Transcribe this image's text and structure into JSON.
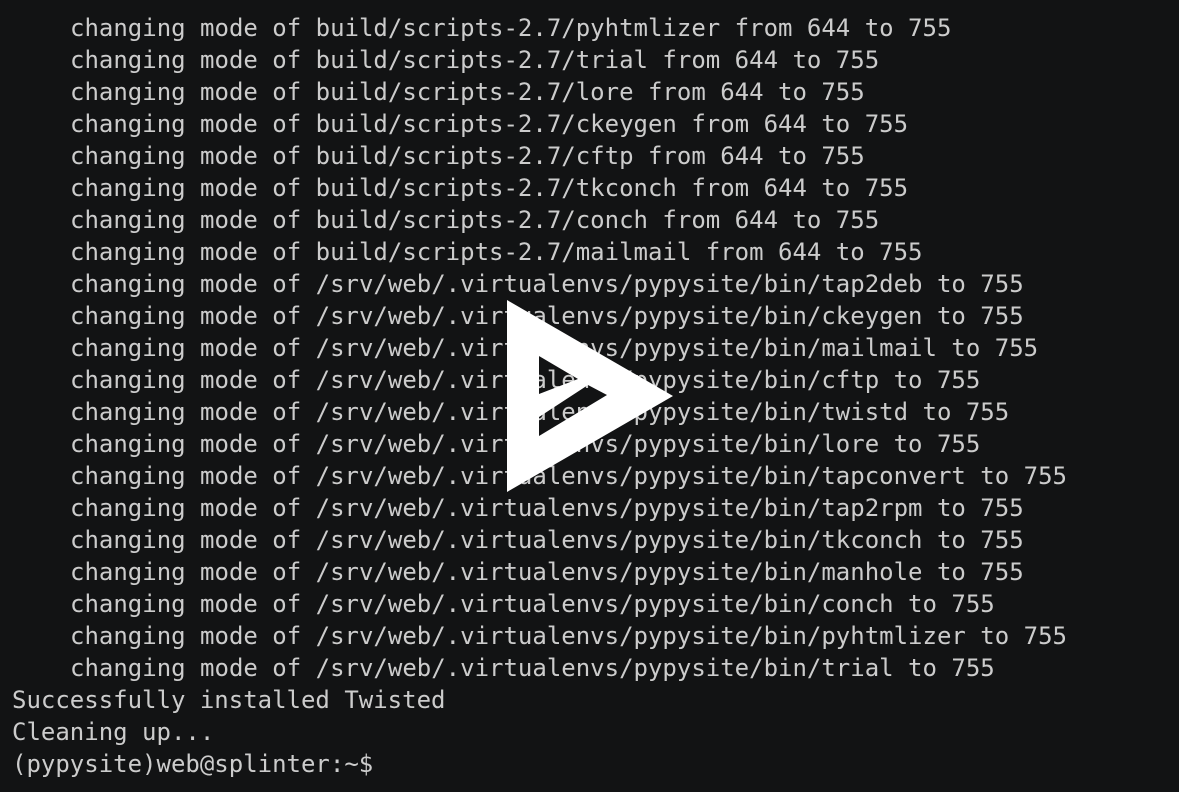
{
  "terminal": {
    "output_lines": [
      "changing mode of build/scripts-2.7/pyhtmlizer from 644 to 755",
      "changing mode of build/scripts-2.7/trial from 644 to 755",
      "changing mode of build/scripts-2.7/lore from 644 to 755",
      "changing mode of build/scripts-2.7/ckeygen from 644 to 755",
      "changing mode of build/scripts-2.7/cftp from 644 to 755",
      "changing mode of build/scripts-2.7/tkconch from 644 to 755",
      "changing mode of build/scripts-2.7/conch from 644 to 755",
      "changing mode of build/scripts-2.7/mailmail from 644 to 755",
      "changing mode of /srv/web/.virtualenvs/pypysite/bin/tap2deb to 755",
      "changing mode of /srv/web/.virtualenvs/pypysite/bin/ckeygen to 755",
      "changing mode of /srv/web/.virtualenvs/pypysite/bin/mailmail to 755",
      "changing mode of /srv/web/.virtualenvs/pypysite/bin/cftp to 755",
      "changing mode of /srv/web/.virtualenvs/pypysite/bin/twistd to 755",
      "changing mode of /srv/web/.virtualenvs/pypysite/bin/lore to 755",
      "changing mode of /srv/web/.virtualenvs/pypysite/bin/tapconvert to 755",
      "changing mode of /srv/web/.virtualenvs/pypysite/bin/tap2rpm to 755",
      "changing mode of /srv/web/.virtualenvs/pypysite/bin/tkconch to 755",
      "changing mode of /srv/web/.virtualenvs/pypysite/bin/manhole to 755",
      "changing mode of /srv/web/.virtualenvs/pypysite/bin/conch to 755",
      "changing mode of /srv/web/.virtualenvs/pypysite/bin/pyhtmlizer to 755",
      "changing mode of /srv/web/.virtualenvs/pypysite/bin/trial to 755"
    ],
    "status_lines": [
      "Successfully installed Twisted",
      "Cleaning up..."
    ],
    "prompt": "(pypysite)web@splinter:~$"
  },
  "overlay": {
    "icon": "play-icon",
    "color": "#ffffff"
  },
  "colors": {
    "background": "#121314",
    "text": "#cccccc"
  }
}
